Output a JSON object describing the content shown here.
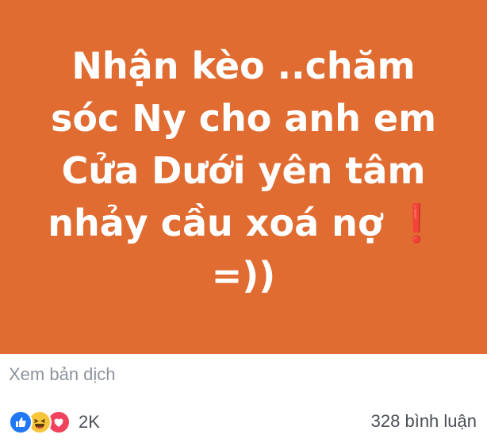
{
  "post": {
    "status_lines": [
      "Nhận kèo ..chăm",
      "sóc Ny cho anh em",
      "Cửa Dưới yên tâm",
      "nhảy cầu xoá nợ",
      "=))"
    ],
    "status_emoji": "❗",
    "background_color": "#e06c32",
    "text_color": "#ffffff"
  },
  "translate": {
    "label": "Xem bản dịch"
  },
  "reactions": {
    "icons": [
      "like-icon",
      "haha-icon",
      "love-icon"
    ],
    "count": "2K"
  },
  "comments": {
    "label": "328 bình luận"
  }
}
